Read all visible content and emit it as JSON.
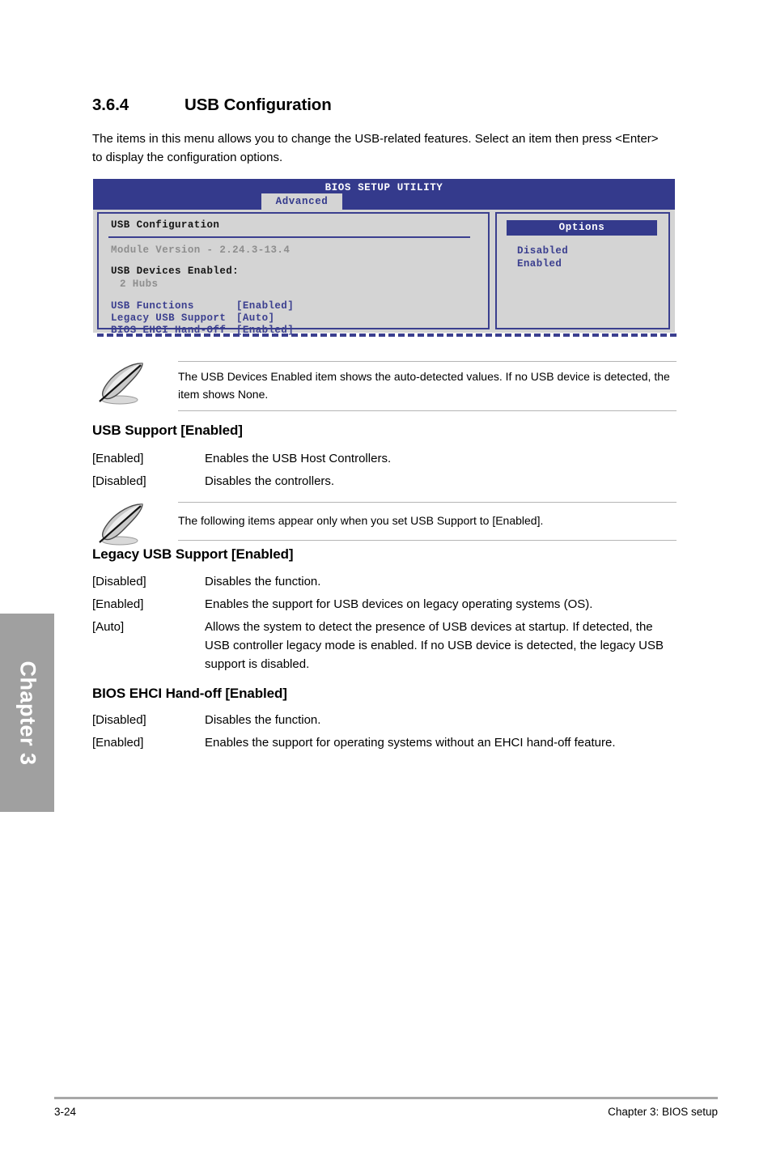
{
  "page": {
    "section_number": "3.6.4",
    "section_title": "USB Configuration",
    "intro": "The items in this menu allows you to change the USB-related features. Select an item then press <Enter> to display the configuration options.",
    "chapter_tab_label": "Chapter 3",
    "footer_page": "3-24",
    "footer_chapter": "Chapter 3: BIOS setup"
  },
  "colors": {
    "bios_blue": "#343a8c",
    "bios_border": "#3b3f8f",
    "bios_bg": "#d4d4d4",
    "chapter_tab": "#a0a0a0",
    "dim_text": "#8e8e8e"
  },
  "bios": {
    "title": "BIOS SETUP UTILITY",
    "active_tab": "Advanced",
    "main_panel": {
      "heading": "USB Configuration",
      "module_version": "Module Version - 2.24.3-13.4",
      "devices_enabled_label": "USB Devices Enabled:",
      "devices_enabled_value": "2 Hubs",
      "items": [
        {
          "label": "USB Functions",
          "value": "[Enabled]"
        },
        {
          "label": "Legacy USB Support",
          "value": "[Auto]"
        },
        {
          "label": "BIOS EHCI Hand-Off",
          "value": "[Enabled]"
        }
      ]
    },
    "options_panel": {
      "heading": "Options",
      "options": [
        "Disabled",
        "Enabled"
      ]
    }
  },
  "notes": [
    {
      "text": "The USB Devices Enabled item shows the auto-detected values. If no USB device is detected, the item shows None."
    },
    {
      "text": "The following items appear only when you set USB Support to [Enabled]."
    }
  ],
  "settings": [
    {
      "heading": "USB Support [Enabled]",
      "rows": [
        {
          "term": "[Enabled]",
          "desc": "Enables the USB Host Controllers."
        },
        {
          "term": "[Disabled]",
          "desc": "Disables the controllers."
        }
      ]
    },
    {
      "heading": "Legacy USB Support [Enabled]",
      "rows": [
        {
          "term": "[Disabled]",
          "desc": "Disables the function."
        },
        {
          "term": "[Enabled]",
          "desc": "Enables the support for USB devices on legacy operating systems (OS)."
        },
        {
          "term": "[Auto]",
          "desc": "Allows the system to detect the presence of USB devices at startup. If detected, the USB controller legacy mode is enabled. If no USB device is detected, the legacy USB support is disabled."
        }
      ]
    },
    {
      "heading": "BIOS EHCI Hand-off [Enabled]",
      "rows": [
        {
          "term": "[Disabled]",
          "desc": "Disables the function."
        },
        {
          "term": "[Enabled]",
          "desc": "Enables the support for operating systems without an EHCI hand-off feature."
        }
      ]
    }
  ]
}
